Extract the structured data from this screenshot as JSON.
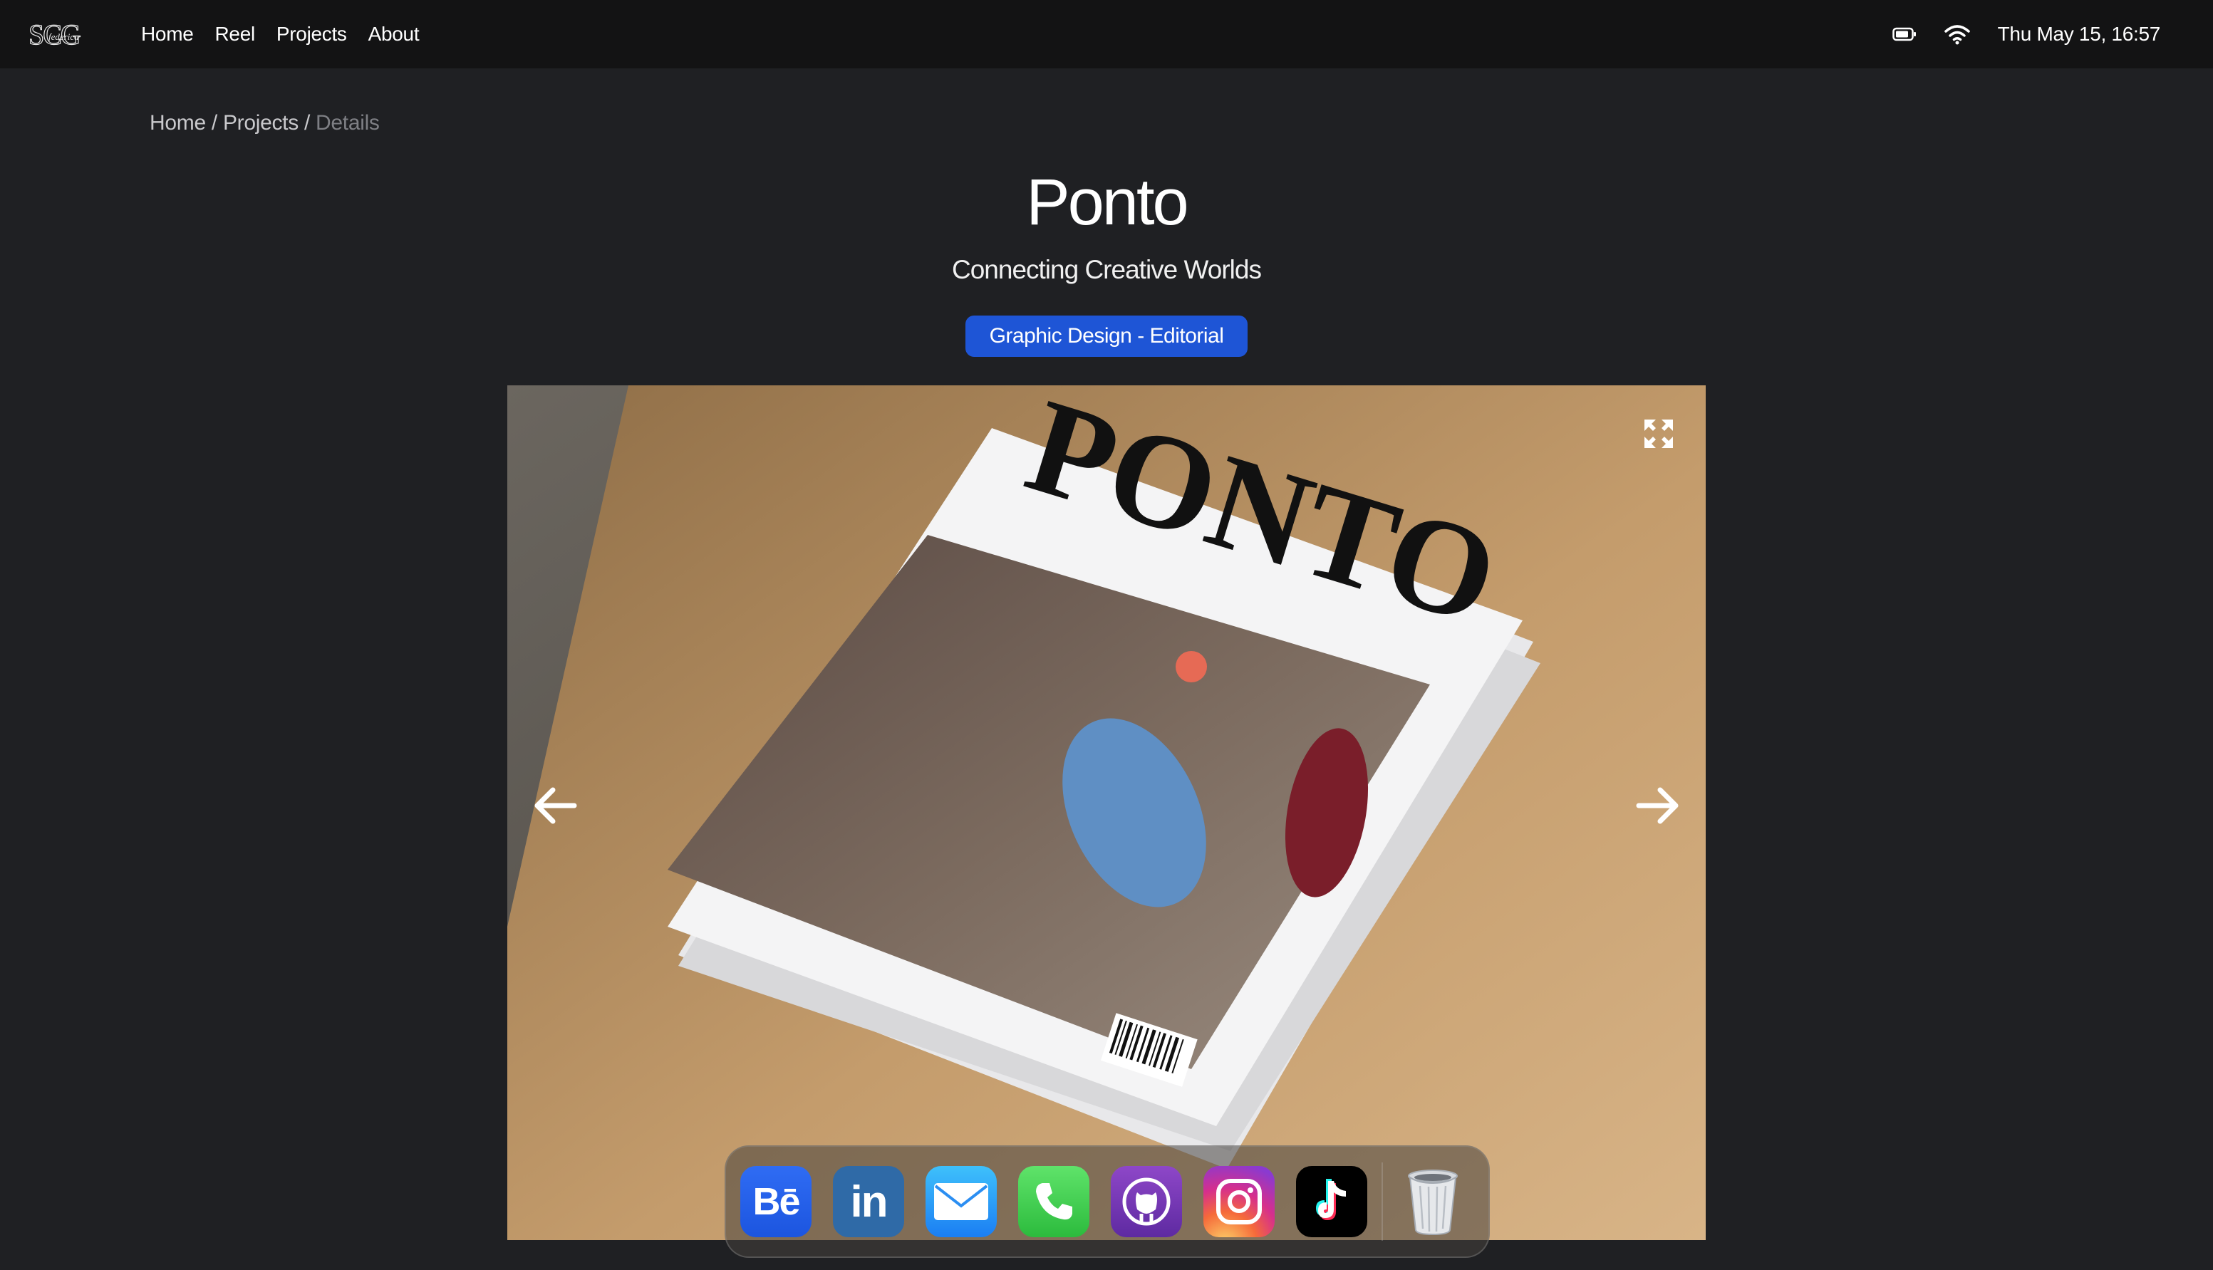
{
  "menubar": {
    "logo_text": "SCG Federica",
    "nav": [
      {
        "label": "Home"
      },
      {
        "label": "Reel"
      },
      {
        "label": "Projects"
      },
      {
        "label": "About"
      }
    ],
    "status": {
      "battery_icon": "battery-icon",
      "wifi_icon": "wifi-icon",
      "clock": "Thu May 15, 16:57"
    }
  },
  "breadcrumb": {
    "home": "Home",
    "sep1": " / ",
    "projects": "Projects",
    "sep2": " / ",
    "current": "Details"
  },
  "project": {
    "title": "Ponto",
    "subtitle": "Connecting Creative Worlds",
    "tag": "Graphic Design - Editorial",
    "tag_color": "#1e55d6"
  },
  "gallery": {
    "image_subject": "PONTO",
    "expand_icon": "expand-icon",
    "prev_icon": "arrow-left-icon",
    "next_icon": "arrow-right-icon"
  },
  "dock": {
    "items": [
      {
        "name": "behance",
        "icon": "behance-icon",
        "glyph": "Bē"
      },
      {
        "name": "linkedin",
        "icon": "linkedin-icon",
        "glyph": "in"
      },
      {
        "name": "mail",
        "icon": "mail-icon"
      },
      {
        "name": "phone",
        "icon": "phone-icon"
      },
      {
        "name": "github",
        "icon": "github-icon"
      },
      {
        "name": "instagram",
        "icon": "instagram-icon"
      },
      {
        "name": "tiktok",
        "icon": "tiktok-icon"
      },
      {
        "name": "trash",
        "icon": "trash-icon"
      }
    ]
  }
}
